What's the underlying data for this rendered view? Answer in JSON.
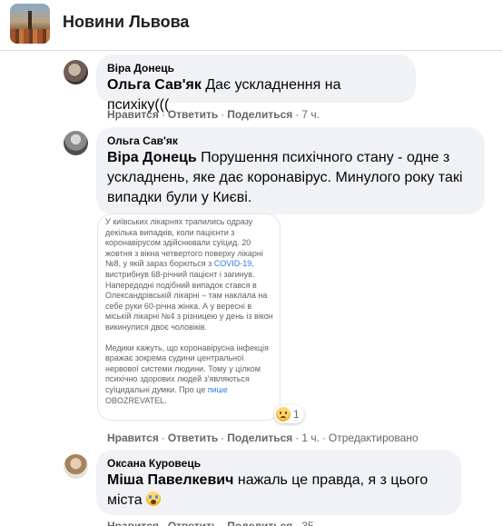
{
  "group": {
    "title": "Новини Львова"
  },
  "actions": {
    "like": "Нравится",
    "reply": "Ответить",
    "share": "Поделиться",
    "separator": "·"
  },
  "comments": [
    {
      "author": "Віра Донець",
      "mention": "Ольга Сав'як",
      "text": " Дає ускладнення на психіку(((",
      "time": "7 ч."
    },
    {
      "author": "Ольга Сав'як",
      "mention": "Віра Донець",
      "text": " Порушення психічного стану - одне з ускладнень, яке дає коронавірус. Минулого року такі випадки були у Києві.",
      "time": "1 ч.",
      "edited": "Отредактировано",
      "image": {
        "paragraph1_before_link": "У київських лікарнях трапились одразу декілька випадків, коли пацієнти з коронавірусом здійснювали суїцид. 20 жовтня з вікна четвертого поверху лікарні №8, у якій зараз борються з ",
        "link1": "COVID-19",
        "paragraph1_after_link": ", вистрибнув 68-річний пацієнт і загинув. Напередодні подібний випадок стався в Олександрівській лікарні – там наклала на себе руки 60-річна жінка. А у вересні в міській лікарні №4 з різницею у день із вікон викинулися двоє чоловіків.",
        "paragraph2_before_link": "Медики кажуть, що коронавірусна інфекція вражає зокрема судини центральної нервової системи людини. Тому у цілком психічно здорових людей з'являються суїцидальні думки. Про це ",
        "link2": "пише",
        "paragraph2_after_link": " OBOZREVATEL."
      },
      "reaction": {
        "icon": "sad-emoji-icon",
        "count": "1"
      }
    },
    {
      "author": "Оксана Куровець",
      "mention": "Міша Павелкевич",
      "text": " нажаль це правда, я з цього міста ",
      "emoji": "crying-emoji-icon",
      "time": "35"
    }
  ]
}
